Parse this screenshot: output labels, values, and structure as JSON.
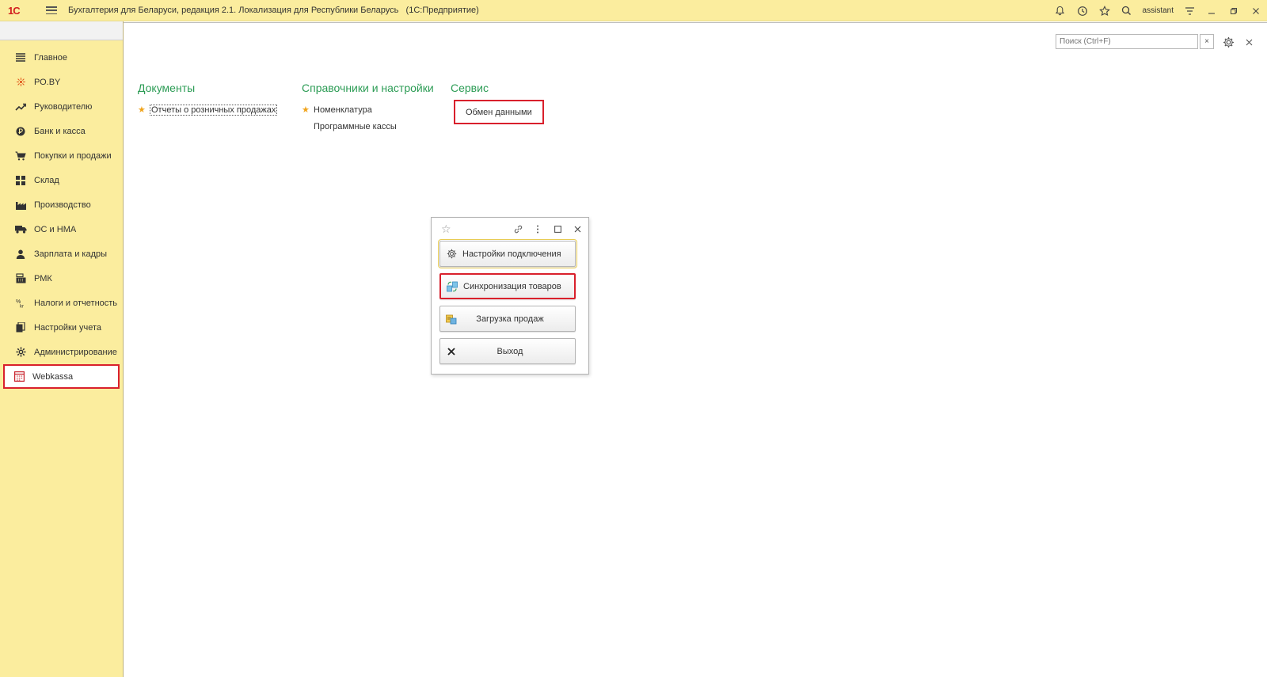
{
  "titlebar": {
    "logo": "1С",
    "title": "Бухгалтерия для Беларуси, редакция 2.1. Локализация для Республики Беларусь",
    "subtitle": "(1С:Предприятие)",
    "user": "assistant"
  },
  "sidebar": {
    "items": [
      {
        "label": "Главное",
        "icon": "list-icon"
      },
      {
        "label": "РО.BY",
        "icon": "roby-icon"
      },
      {
        "label": "Руководителю",
        "icon": "chart-trend-icon"
      },
      {
        "label": "Банк и касса",
        "icon": "coin-icon"
      },
      {
        "label": "Покупки и продажи",
        "icon": "cart-icon"
      },
      {
        "label": "Склад",
        "icon": "grid-icon"
      },
      {
        "label": "Производство",
        "icon": "factory-icon"
      },
      {
        "label": "ОС и НМА",
        "icon": "truck-icon"
      },
      {
        "label": "Зарплата и кадры",
        "icon": "person-icon"
      },
      {
        "label": "РМК",
        "icon": "register-icon"
      },
      {
        "label": "Налоги и отчетность",
        "icon": "tax-icon"
      },
      {
        "label": "Настройки учета",
        "icon": "documents-icon"
      },
      {
        "label": "Администрирование",
        "icon": "gear-icon"
      },
      {
        "label": "Webkassa",
        "icon": "calendar-icon"
      }
    ]
  },
  "content": {
    "search_placeholder": "Поиск (Ctrl+F)",
    "sections": {
      "documents": {
        "title": "Документы",
        "links": [
          "Отчеты о розничных продажах"
        ]
      },
      "catalogs": {
        "title": "Справочники и настройки",
        "links": [
          "Номенклатура",
          "Программные кассы"
        ]
      },
      "service": {
        "title": "Сервис",
        "links": [
          "Обмен данными"
        ]
      }
    }
  },
  "dialog": {
    "buttons": {
      "settings": "Настройки подключения",
      "sync": "Синхронизация товаров",
      "load": "Загрузка продаж",
      "exit": "Выход"
    }
  },
  "colors": {
    "panel": "#fbed9e",
    "section_title": "#2c9c55",
    "highlight": "#d9202c",
    "star": "#f0a31a"
  }
}
